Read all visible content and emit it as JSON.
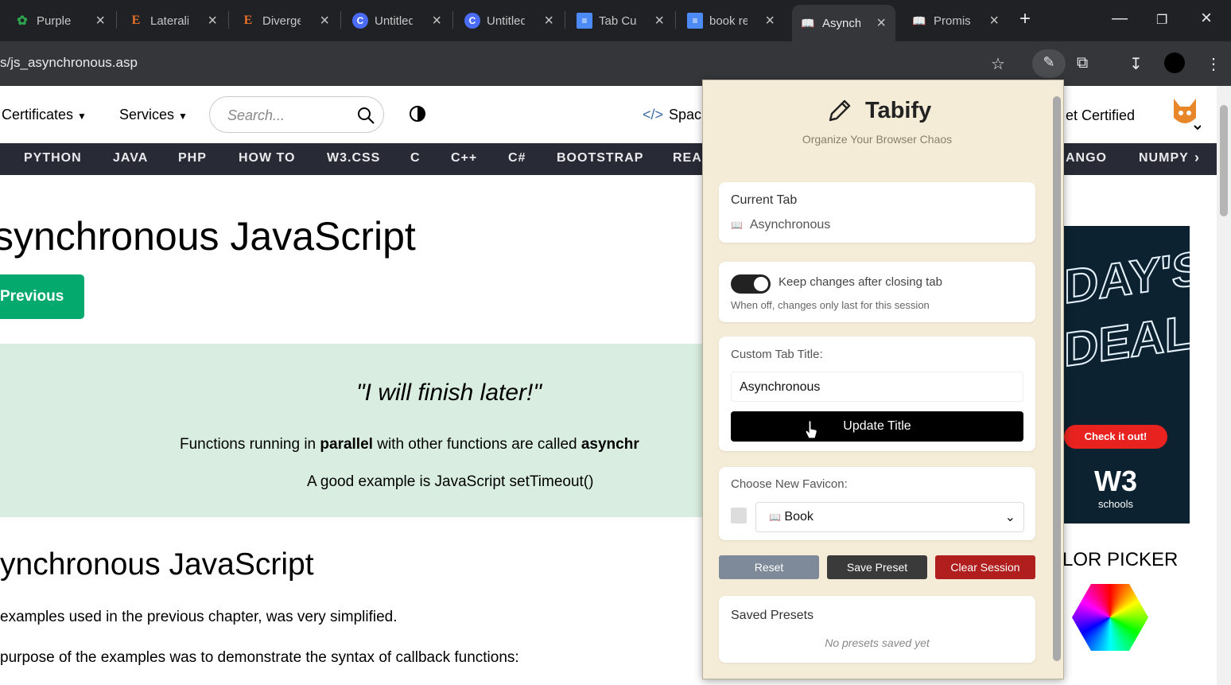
{
  "browser": {
    "tabs": [
      {
        "title": "Purple",
        "icon": "green-leaf-icon",
        "color": "#2ea44f"
      },
      {
        "title": "Laterali",
        "icon": "E",
        "color": "#e8702a"
      },
      {
        "title": "Diverge",
        "icon": "E",
        "color": "#e8702a"
      },
      {
        "title": "Untitled",
        "icon": "C",
        "color": "#4a6cf7"
      },
      {
        "title": "Untitled",
        "icon": "C",
        "color": "#4a6cf7"
      },
      {
        "title": "Tab Cus",
        "icon": "docs-icon",
        "color": "#4c8bf5"
      },
      {
        "title": "book re",
        "icon": "docs-icon",
        "color": "#4c8bf5"
      },
      {
        "title": "Asynch",
        "icon": "book-icon",
        "color": "#dfe6f5"
      },
      {
        "title": "Promis",
        "icon": "book-icon",
        "color": "#dfe6f5"
      }
    ],
    "url": "s/js_asynchronous.asp"
  },
  "site": {
    "nav": {
      "certificates": "Certificates",
      "services": "Services",
      "search_placeholder": "Search...",
      "spaces": "Spac",
      "get_certified": "et Certified"
    },
    "menu": [
      "PYTHON",
      "JAVA",
      "PHP",
      "HOW TO",
      "W3.CSS",
      "C",
      "C++",
      "C#",
      "BOOTSTRAP",
      "REA",
      "ANGO",
      "NUMPY"
    ],
    "heading": "synchronous JavaScript",
    "previous": "Previous",
    "quote": "\"I will finish later!\"",
    "para_prefix": "Functions running in ",
    "para_bold1": "parallel",
    "para_mid": " with other functions are called ",
    "para_bold2": "asynchr",
    "example": "A good example is JavaScript setTimeout()",
    "heading2": "ynchronous JavaScript",
    "p1": "examples used in the previous chapter, was very simplified.",
    "p2": "purpose of the examples was to demonstrate the syntax of callback functions:",
    "ad": {
      "line1": "DAY'S",
      "line2": "DEAL",
      "cta": "Check it out!",
      "logo": "W3",
      "logo_sub": "schools"
    },
    "color_picker": "LOR PICKER"
  },
  "popup": {
    "title": "Tabify",
    "subtitle": "Organize Your Browser Chaos",
    "current_tab_label": "Current Tab",
    "current_tab_value": "Asynchronous",
    "keep_label": "Keep changes after closing tab",
    "keep_hint": "When off, changes only last for this session",
    "keep_on": true,
    "custom_title_label": "Custom Tab Title:",
    "custom_title_value": "Asynchronous",
    "update_button": "Update Title",
    "favicon_label": "Choose New Favicon:",
    "favicon_selected": "Book",
    "reset": "Reset",
    "save_preset": "Save Preset",
    "clear_session": "Clear Session",
    "saved_presets_label": "Saved Presets",
    "no_presets": "No presets saved yet"
  }
}
